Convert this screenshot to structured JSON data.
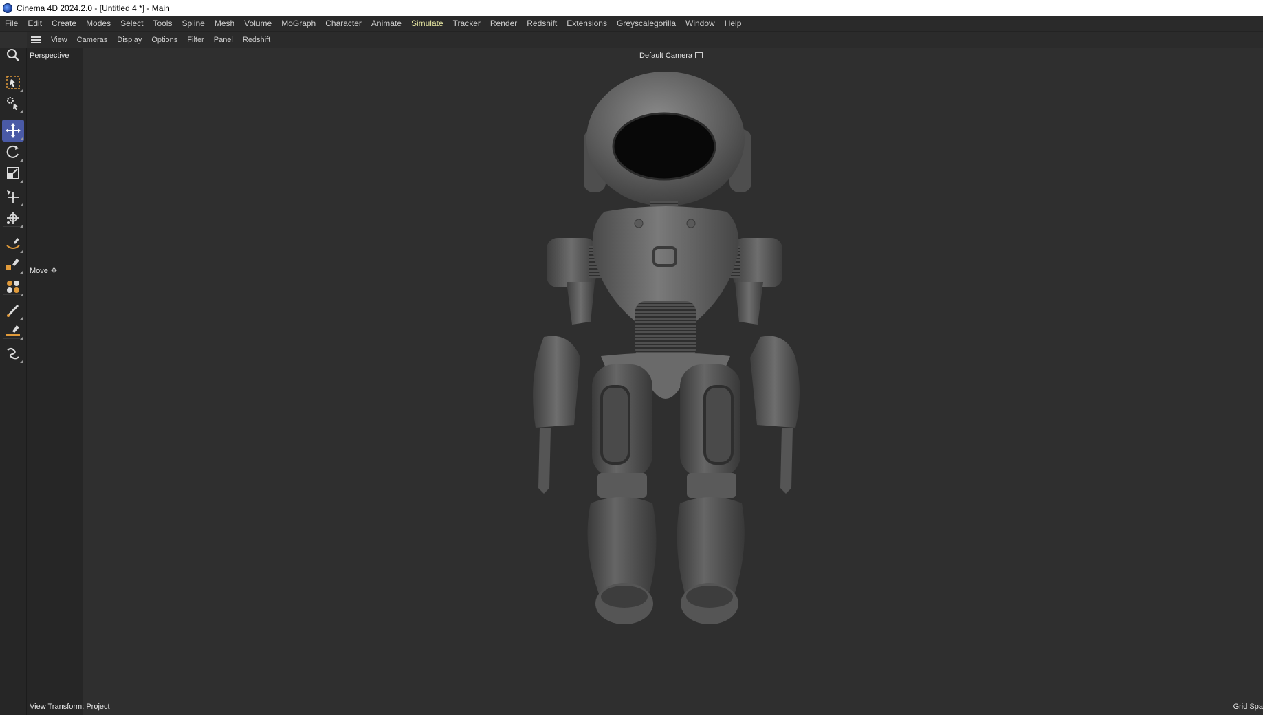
{
  "window": {
    "title": "Cinema 4D 2024.2.0 - [Untitled 4 *] - Main",
    "minimize_glyph": "—"
  },
  "menubar": {
    "items": [
      "File",
      "Edit",
      "Create",
      "Modes",
      "Select",
      "Tools",
      "Spline",
      "Mesh",
      "Volume",
      "MoGraph",
      "Character",
      "Animate",
      "Simulate",
      "Tracker",
      "Render",
      "Redshift",
      "Extensions",
      "Greyscalegorilla",
      "Window",
      "Help"
    ],
    "active": "Simulate",
    "active_color": "#e4e4a0"
  },
  "viewport_menu": {
    "items": [
      "View",
      "Cameras",
      "Display",
      "Options",
      "Filter",
      "Panel",
      "Redshift"
    ]
  },
  "toolbar": {
    "tools": [
      {
        "icon": "zoom-icon"
      },
      {
        "icon": "live-selection-icon"
      },
      {
        "icon": "tweak-icon"
      },
      {
        "icon": "move-icon",
        "selected": true
      },
      {
        "icon": "rotate-icon"
      },
      {
        "icon": "scale-icon"
      },
      {
        "icon": "transform-icon"
      },
      {
        "icon": "soft-transform-icon"
      },
      {
        "icon": "spline-pen-arc-icon"
      },
      {
        "icon": "spline-pen-point-icon"
      },
      {
        "icon": "generators-icon"
      },
      {
        "icon": "brush-icon"
      },
      {
        "icon": "spline-pen-line-icon"
      },
      {
        "icon": "sketch-icon"
      }
    ],
    "selected_color": "#4a5aa6"
  },
  "viewport": {
    "projection_label": "Perspective",
    "camera_label": "Default Camera",
    "tool_label": "Move",
    "tool_glyph": "✥",
    "view_transform": "View Transform: Project",
    "grid_label": "Grid Spa"
  }
}
